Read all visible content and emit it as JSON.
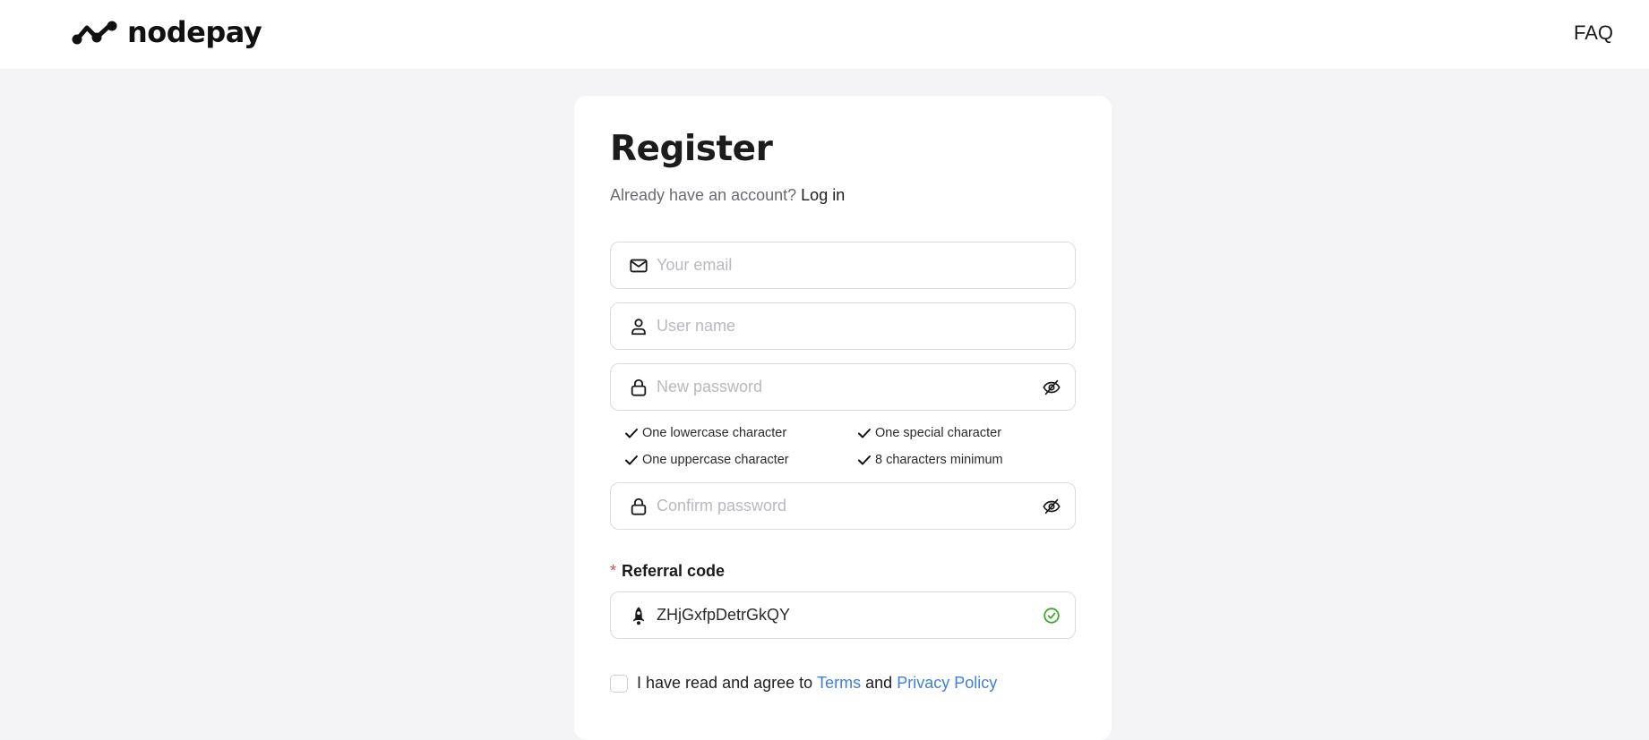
{
  "header": {
    "brand": "nodepay",
    "nav": {
      "faq_label": "FAQ"
    }
  },
  "register": {
    "title": "Register",
    "subtitle_prefix": "Already have an account?",
    "login_link": "Log in",
    "fields": {
      "email": {
        "placeholder": "Your email",
        "value": "",
        "icon": "mail-icon"
      },
      "username": {
        "placeholder": "User name",
        "value": "",
        "icon": "user-icon"
      },
      "new_password": {
        "placeholder": "New password",
        "value": "",
        "icon": "lock-icon",
        "toggle_icon": "eye-off-icon"
      },
      "confirm_password": {
        "placeholder": "Confirm password",
        "value": "",
        "icon": "lock-icon",
        "toggle_icon": "eye-off-icon"
      }
    },
    "password_rules": [
      {
        "label": "One lowercase character",
        "icon": "check-icon"
      },
      {
        "label": "One special character",
        "icon": "check-icon"
      },
      {
        "label": "One uppercase character",
        "icon": "check-icon"
      },
      {
        "label": "8 characters minimum",
        "icon": "check-icon"
      }
    ],
    "referral": {
      "required_mark": "*",
      "label": "Referral code",
      "value": "ZHjGxfpDetrGkQY",
      "icon": "rocket-icon",
      "status_icon": "check-circle-icon",
      "status_color": "#3ea82c"
    },
    "agreement": {
      "checked": false,
      "prefix": "I have read and agree to",
      "terms_link": "Terms",
      "conjunction": "and",
      "privacy_link": "Privacy Policy",
      "link_color": "#3f7fd9"
    }
  }
}
